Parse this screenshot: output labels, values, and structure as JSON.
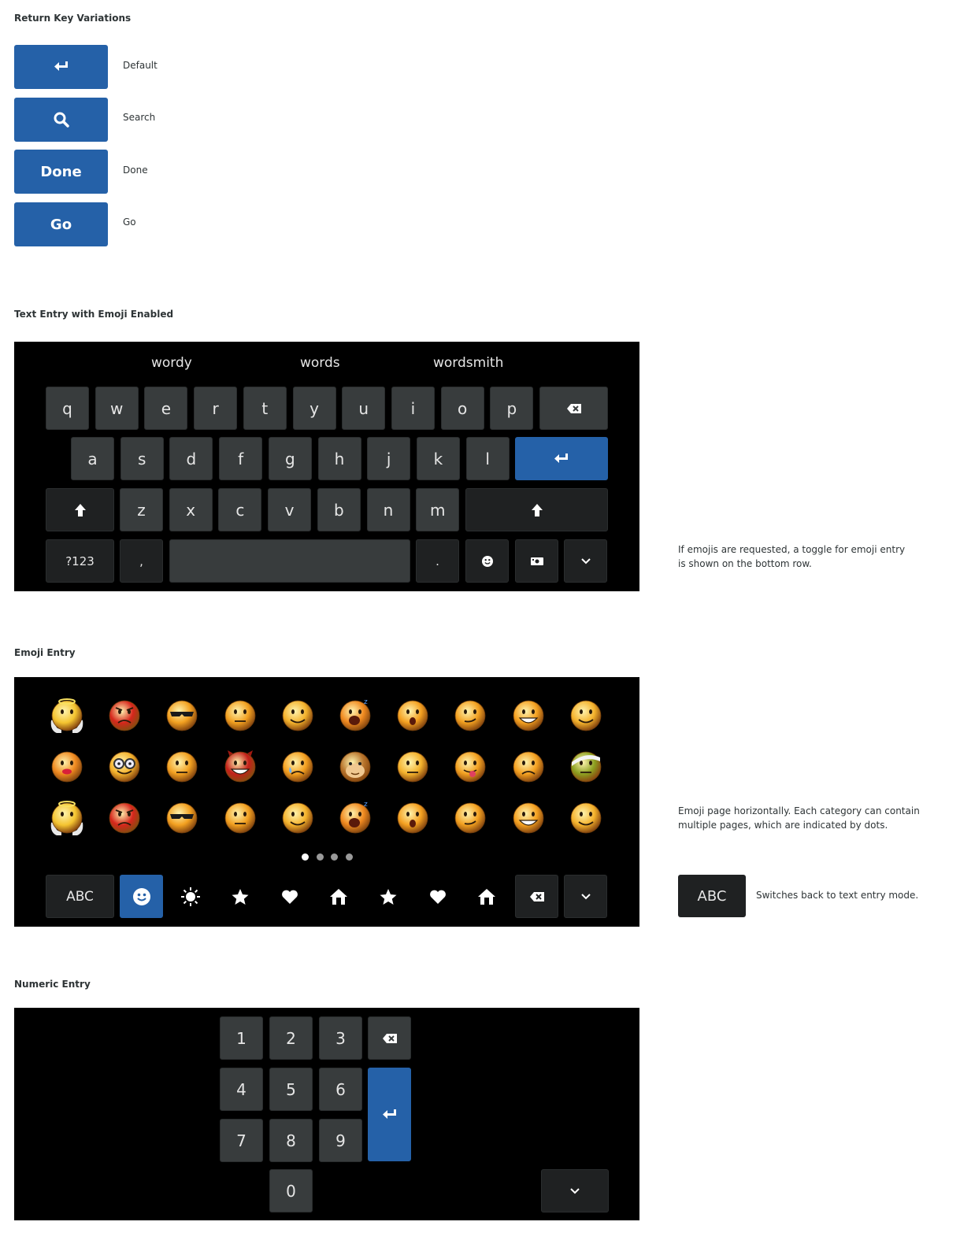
{
  "sections": {
    "return_keys": {
      "heading": "Return Key Variations",
      "items": [
        {
          "key_label": "",
          "icon": "return-icon",
          "label": "Default"
        },
        {
          "key_label": "",
          "icon": "search-icon",
          "label": "Search"
        },
        {
          "key_label": "Done",
          "icon": "",
          "label": "Done"
        },
        {
          "key_label": "Go",
          "icon": "",
          "label": "Go"
        }
      ]
    },
    "text_entry": {
      "heading": "Text Entry with Emoji Enabled",
      "suggestions": [
        "wordy",
        "words",
        "wordsmith"
      ],
      "row1": [
        "q",
        "w",
        "e",
        "r",
        "t",
        "y",
        "u",
        "i",
        "o",
        "p"
      ],
      "row2": [
        "a",
        "s",
        "d",
        "f",
        "g",
        "h",
        "j",
        "k",
        "l"
      ],
      "row3": [
        "z",
        "x",
        "c",
        "v",
        "b",
        "n",
        "m"
      ],
      "bottom": {
        "numbers_label": "?123",
        "comma": ",",
        "period": "."
      },
      "note": "If emojis are requested, a toggle for emoji entry is shown on the bottom row."
    },
    "emoji_entry": {
      "heading": "Emoji Entry",
      "rows": [
        [
          "angel-emoji",
          "angry-emoji",
          "cool-emoji",
          "worried-emoji",
          "smile-emoji",
          "sleepy-emoji",
          "surprised-emoji",
          "smirk-emoji",
          "grin-emoji",
          "happy-emoji"
        ],
        [
          "kiss-emoji",
          "nerd-emoji",
          "confused-emoji",
          "devil-emoji",
          "crying-emoji",
          "monkey-emoji",
          "neutral-emoji",
          "tongue-emoji",
          "sad-emoji",
          "sick-emoji"
        ],
        [
          "angel-emoji",
          "angry-emoji",
          "cool-emoji",
          "worried-emoji",
          "smile-emoji",
          "sleepy-emoji",
          "surprised-emoji",
          "smirk-emoji",
          "grin-emoji",
          "happy-emoji"
        ]
      ],
      "page_count": 4,
      "active_page": 1,
      "abc_label": "ABC",
      "categories": [
        "smiley-icon",
        "sun-icon",
        "star-icon",
        "heart-icon",
        "home-icon",
        "star-icon",
        "heart-icon",
        "home-icon"
      ],
      "note": "Emoji page horizontally. Each category can contain multiple pages, which are indicated by dots.",
      "abc_note": "Switches back to text entry mode."
    },
    "numeric_entry": {
      "heading": "Numeric Entry",
      "digits": [
        "1",
        "2",
        "3",
        "4",
        "5",
        "6",
        "7",
        "8",
        "9",
        "0"
      ]
    }
  }
}
